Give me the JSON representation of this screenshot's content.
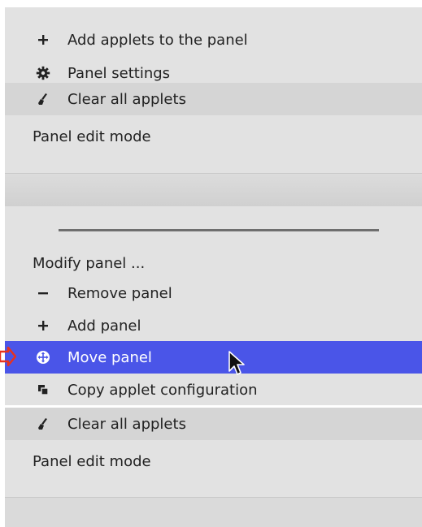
{
  "top_menu": {
    "items": [
      {
        "label": "Add applets to the panel",
        "icon": "plus-icon"
      },
      {
        "label": "Panel settings",
        "icon": "gear-icon"
      },
      {
        "label": "Clear all applets",
        "icon": "broom-icon"
      }
    ],
    "panel_edit_mode": "Panel edit mode"
  },
  "bottom_menu": {
    "header": "Modify panel ...",
    "items": [
      {
        "label": "Remove panel",
        "icon": "minus-icon"
      },
      {
        "label": "Add panel",
        "icon": "plus-icon"
      },
      {
        "label": "Move panel",
        "icon": "move-icon",
        "selected": true
      },
      {
        "label": "Copy applet configuration",
        "icon": "copy-icon"
      },
      {
        "label": "Clear all applets",
        "icon": "broom-icon"
      }
    ],
    "panel_edit_mode": "Panel edit mode"
  },
  "colors": {
    "menu_background": "#e2e2e2",
    "hover_background": "#d5d5d5",
    "selected_background": "#4a55e8",
    "selected_text": "#ffffff",
    "pointer_arrow": "#e8321e"
  }
}
